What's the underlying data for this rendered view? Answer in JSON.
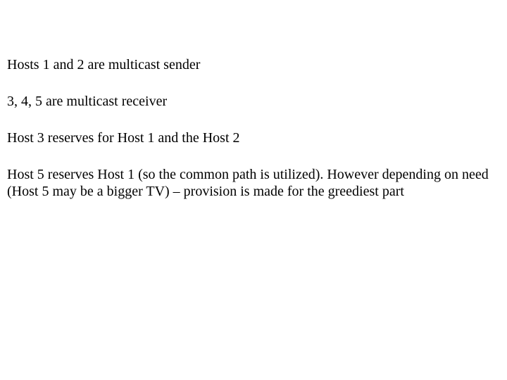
{
  "paragraphs": {
    "p1": "Hosts 1 and 2 are multicast sender",
    "p2": "3, 4, 5 are multicast receiver",
    "p3": "Host 3 reserves for Host 1 and the Host 2",
    "p4": "Host 5 reserves Host 1 (so the common path is utilized). However depending on need (Host 5 may be a bigger TV) – provision is made for the greediest part"
  }
}
